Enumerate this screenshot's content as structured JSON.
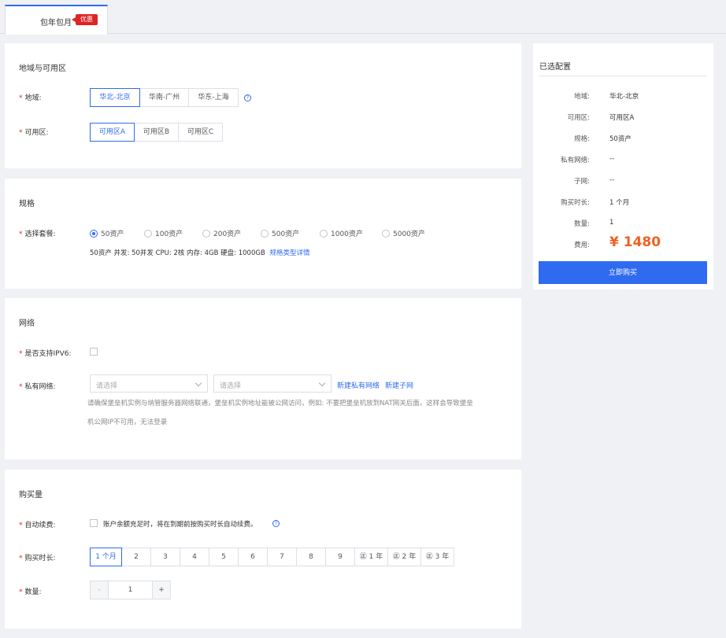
{
  "tabs": [
    {
      "label": "包年包月",
      "badge": "优惠"
    }
  ],
  "region": {
    "title": "地域与可用区",
    "region_label": "地域:",
    "regions": [
      "华北-北京",
      "华南-广州",
      "华东-上海"
    ],
    "zone_label": "可用区:",
    "zones": [
      "可用区A",
      "可用区B",
      "可用区C"
    ]
  },
  "spec": {
    "title": "规格",
    "package_label": "选择套餐:",
    "packages": [
      "50资产",
      "100资产",
      "200资产",
      "500资产",
      "1000资产",
      "5000资产"
    ],
    "selected": "50资产",
    "detail": "50资产 并发: 50并发 CPU: 2核 内存: 4GB 硬盘: 1000GB",
    "detail_link": "规格类型详情"
  },
  "network": {
    "title": "网络",
    "ipv6_label": "是否支持IPV6:",
    "vpc_label": "私有网络:",
    "select1_placeholder": "请选择",
    "select2_placeholder": "请选择",
    "new_vpc_link": "新建私有网络",
    "new_subnet_link": "新建子网",
    "hint_line1": "请确保堡垒机实例与纳管服务器网络联通，堡垒机实例地址能被公网访问，例如: 不要把堡垒机放到NAT网关后面，这样会导致堡垒",
    "hint_line2": "机公网IP不可用，无法登录"
  },
  "purchase": {
    "title": "购买量",
    "renew_label": "自动续费:",
    "renew_text": "账户余额充足时，将在到期前按购买时长自动续费。",
    "duration_label": "购买时长:",
    "durations": [
      "1 个月",
      "2",
      "3",
      "4",
      "5",
      "6",
      "7",
      "8",
      "9",
      "1 年",
      "2 年",
      "3 年"
    ],
    "gift_mark": "㊣",
    "quantity_label": "数量:",
    "quantity_minus": "-",
    "quantity_value": "1",
    "quantity_plus": "+"
  },
  "summary": {
    "title": "已选配置",
    "rows": [
      {
        "k": "地域:",
        "v": "华北-北京"
      },
      {
        "k": "可用区:",
        "v": "可用区A"
      },
      {
        "k": "规格:",
        "v": "50资产"
      },
      {
        "k": "私有网络:",
        "v": "--"
      },
      {
        "k": "子网:",
        "v": "--"
      },
      {
        "k": "购买时长:",
        "v": "1 个月"
      },
      {
        "k": "数量:",
        "v": "1"
      }
    ],
    "fee_label": "费用:",
    "price": "¥ 1480",
    "buy_button": "立即购买"
  },
  "colors": {
    "accent": "#2f6bf0",
    "price": "#f06021",
    "required": "#e02424",
    "badge": "#e02424"
  }
}
